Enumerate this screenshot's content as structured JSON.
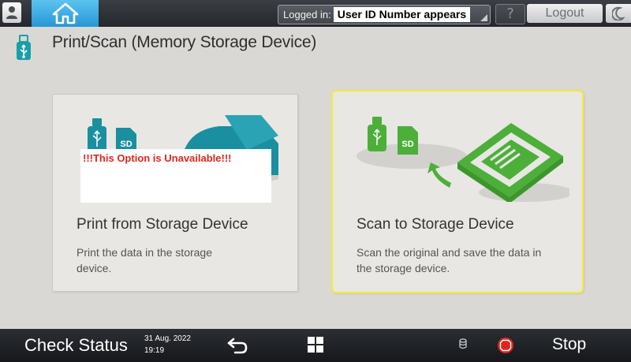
{
  "header": {
    "login_label": "Logged in:",
    "login_user": "User ID Number appears",
    "help_label": "?",
    "logout_label": "Logout"
  },
  "page": {
    "title": "Print/Scan (Memory Storage Device)"
  },
  "cards": [
    {
      "title": "Print from Storage Device",
      "description": "Print the data in the storage device.",
      "notice": "!!!This Option is Unavailable!!!",
      "sd_label": "SD"
    },
    {
      "title": "Scan to Storage Device",
      "description": "Scan the original and save the data in the storage device.",
      "sd_label": "SD"
    }
  ],
  "footer": {
    "check_status": "Check Status",
    "date": "31 Aug. 2022",
    "time": "19:19",
    "stop_label": "Stop"
  },
  "icons": [
    "user-icon",
    "home-icon",
    "usb-icon",
    "moon-icon",
    "back-icon",
    "apps-grid-icon",
    "storage-icon",
    "stop-icon"
  ],
  "colors": {
    "home_blue": "#2896d6",
    "usb_teal": "#1a9fa8",
    "scan_green": "#4caf3a",
    "print_teal": "#1a8fa0",
    "selection_yellow": "#f1ec35",
    "notice_red": "#e0261c"
  }
}
